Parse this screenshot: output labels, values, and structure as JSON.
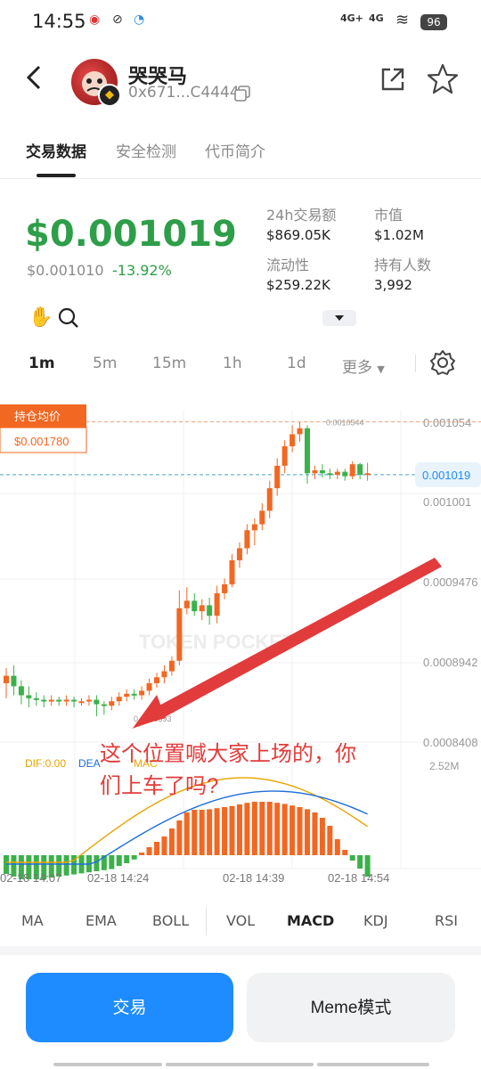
{
  "status": {
    "time": "14:55",
    "net1": "4G+",
    "net2": "4G",
    "battery": "96"
  },
  "header": {
    "token_name": "哭哭马",
    "address": "0x671...C4444"
  },
  "tabs": [
    "交易数据",
    "安全检测",
    "代币简介"
  ],
  "price": {
    "main": "$0.001019",
    "sub": "$0.001010",
    "change": "-13.92%"
  },
  "stats": [
    {
      "label": "24h交易额",
      "value": "$869.05K"
    },
    {
      "label": "市值",
      "value": "$1.02M"
    },
    {
      "label": "流动性",
      "value": "$259.22K"
    },
    {
      "label": "持有人数",
      "value": "3,992"
    }
  ],
  "timeframes": [
    "1m",
    "5m",
    "15m",
    "1h",
    "1d",
    "更多"
  ],
  "chart_data": {
    "type": "candlestick",
    "y_ticks": [
      "0.001054",
      "0.001001",
      "0.0009476",
      "0.0008942",
      "0.0008408"
    ],
    "current_price": "0.001019",
    "high_marker": "0.0010544",
    "low_marker": "0.0008593",
    "x_ticks": [
      "02-18 14:07",
      "02-18 14:24",
      "02-18 14:39",
      "02-18 14:54"
    ],
    "avg_cost_label": "持仓均价",
    "avg_cost_value": "$0.001780",
    "watermark": "TOKEN POCKET",
    "macd_labels": {
      "dif": "DIF:0.00",
      "dea": "DEA",
      "macd": "MAC"
    },
    "macd_axis": "2.52M",
    "annotation": "这个位置喊大家上场的，你们上车了吗?",
    "candles": [
      {
        "o": 0.00088,
        "c": 0.000885,
        "h": 0.00089,
        "l": 0.00087
      },
      {
        "o": 0.000885,
        "c": 0.000878,
        "h": 0.000892,
        "l": 0.000872
      },
      {
        "o": 0.000878,
        "c": 0.000872,
        "h": 0.000882,
        "l": 0.000866
      },
      {
        "o": 0.000872,
        "c": 0.00087,
        "h": 0.000878,
        "l": 0.000864
      },
      {
        "o": 0.00087,
        "c": 0.000869,
        "h": 0.000874,
        "l": 0.000865
      },
      {
        "o": 0.000869,
        "c": 0.000868,
        "h": 0.000872,
        "l": 0.000864
      },
      {
        "o": 0.000868,
        "c": 0.000869,
        "h": 0.000872,
        "l": 0.000865
      },
      {
        "o": 0.000869,
        "c": 0.000868,
        "h": 0.000871,
        "l": 0.000865
      },
      {
        "o": 0.000868,
        "c": 0.000869,
        "h": 0.000872,
        "l": 0.000865
      },
      {
        "o": 0.000869,
        "c": 0.000868,
        "h": 0.000871,
        "l": 0.000864
      },
      {
        "o": 0.000868,
        "c": 0.000868,
        "h": 0.00087,
        "l": 0.000865
      },
      {
        "o": 0.000868,
        "c": 0.000869,
        "h": 0.000872,
        "l": 0.000865
      },
      {
        "o": 0.000869,
        "c": 0.000866,
        "h": 0.000872,
        "l": 0.000858
      },
      {
        "o": 0.000866,
        "c": 0.000865,
        "h": 0.000868,
        "l": 0.000859
      },
      {
        "o": 0.000865,
        "c": 0.000868,
        "h": 0.000871,
        "l": 0.000862
      },
      {
        "o": 0.000868,
        "c": 0.000871,
        "h": 0.000874,
        "l": 0.000865
      },
      {
        "o": 0.000871,
        "c": 0.000873,
        "h": 0.000876,
        "l": 0.000868
      },
      {
        "o": 0.000873,
        "c": 0.000872,
        "h": 0.000876,
        "l": 0.000869
      },
      {
        "o": 0.000872,
        "c": 0.000875,
        "h": 0.000878,
        "l": 0.000869
      },
      {
        "o": 0.000875,
        "c": 0.00088,
        "h": 0.000883,
        "l": 0.000872
      },
      {
        "o": 0.00088,
        "c": 0.000884,
        "h": 0.000887,
        "l": 0.000877
      },
      {
        "o": 0.000884,
        "c": 0.000888,
        "h": 0.000892,
        "l": 0.00088
      },
      {
        "o": 0.000888,
        "c": 0.000895,
        "h": 0.000898,
        "l": 0.000885
      },
      {
        "o": 0.000895,
        "c": 0.00093,
        "h": 0.000942,
        "l": 0.000892
      },
      {
        "o": 0.00093,
        "c": 0.000935,
        "h": 0.000944,
        "l": 0.000926
      },
      {
        "o": 0.000935,
        "c": 0.000928,
        "h": 0.00094,
        "l": 0.000925
      },
      {
        "o": 0.000928,
        "c": 0.000932,
        "h": 0.000936,
        "l": 0.000922
      },
      {
        "o": 0.000932,
        "c": 0.000925,
        "h": 0.000937,
        "l": 0.000919
      },
      {
        "o": 0.000925,
        "c": 0.00094,
        "h": 0.000945,
        "l": 0.00092
      },
      {
        "o": 0.00094,
        "c": 0.000946,
        "h": 0.00095,
        "l": 0.000936
      },
      {
        "o": 0.000946,
        "c": 0.000962,
        "h": 0.000966,
        "l": 0.000944
      },
      {
        "o": 0.000962,
        "c": 0.00097,
        "h": 0.000974,
        "l": 0.000957
      },
      {
        "o": 0.00097,
        "c": 0.000982,
        "h": 0.000986,
        "l": 0.000966
      },
      {
        "o": 0.000982,
        "c": 0.000986,
        "h": 0.00099,
        "l": 0.000972
      },
      {
        "o": 0.000986,
        "c": 0.000995,
        "h": 0.001,
        "l": 0.000982
      },
      {
        "o": 0.000995,
        "c": 0.00101,
        "h": 0.001015,
        "l": 0.00099
      },
      {
        "o": 0.00101,
        "c": 0.001025,
        "h": 0.00103,
        "l": 0.001005
      },
      {
        "o": 0.001025,
        "c": 0.001038,
        "h": 0.001042,
        "l": 0.00102
      },
      {
        "o": 0.001038,
        "c": 0.001046,
        "h": 0.001052,
        "l": 0.001034
      },
      {
        "o": 0.001046,
        "c": 0.00105,
        "h": 0.001054,
        "l": 0.001041
      },
      {
        "o": 0.00105,
        "c": 0.00102,
        "h": 0.001052,
        "l": 0.001013
      },
      {
        "o": 0.00102,
        "c": 0.001022,
        "h": 0.001025,
        "l": 0.001016
      },
      {
        "o": 0.001022,
        "c": 0.00102,
        "h": 0.001026,
        "l": 0.001017
      },
      {
        "o": 0.00102,
        "c": 0.001019,
        "h": 0.001023,
        "l": 0.001016
      },
      {
        "o": 0.001019,
        "c": 0.001021,
        "h": 0.001023,
        "l": 0.001016
      },
      {
        "o": 0.001021,
        "c": 0.001018,
        "h": 0.001023,
        "l": 0.001015
      },
      {
        "o": 0.001018,
        "c": 0.001026,
        "h": 0.001028,
        "l": 0.001016
      },
      {
        "o": 0.001026,
        "c": 0.001019,
        "h": 0.001027,
        "l": 0.001016
      },
      {
        "o": 0.001019,
        "c": 0.00102,
        "h": 0.001027,
        "l": 0.001015
      }
    ],
    "macd_hist": [
      -0.35,
      -0.4,
      -0.45,
      -0.45,
      -0.45,
      -0.45,
      -0.42,
      -0.4,
      -0.38,
      -0.36,
      -0.34,
      -0.32,
      -0.3,
      -0.28,
      -0.26,
      -0.2,
      -0.15,
      -0.08,
      0.05,
      0.15,
      0.25,
      0.35,
      0.5,
      0.65,
      0.8,
      0.85,
      0.85,
      0.86,
      0.88,
      0.9,
      0.92,
      0.95,
      0.98,
      1.0,
      1.0,
      1.0,
      0.98,
      0.96,
      0.93,
      0.9,
      0.86,
      0.8,
      0.7,
      0.55,
      0.3,
      0.1,
      -0.1,
      -0.25,
      -0.4
    ]
  },
  "indicators": [
    "MA",
    "EMA",
    "BOLL",
    "VOL",
    "MACD",
    "KDJ",
    "RSI"
  ],
  "actions": {
    "trade": "交易",
    "meme": "Meme模式"
  },
  "colors": {
    "up": "#f26722",
    "down": "#3bb14a",
    "accent": "#1e8cff",
    "annotation": "#e23b3b"
  }
}
